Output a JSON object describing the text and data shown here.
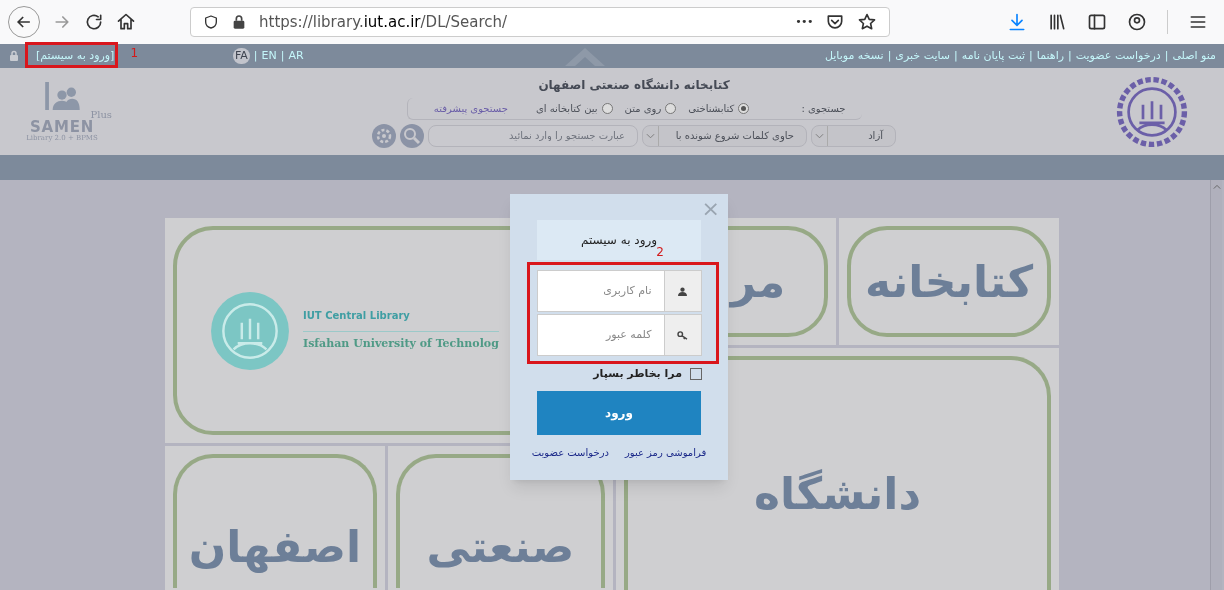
{
  "browser": {
    "url_prefix": "https://library.",
    "url_host": "iut.ac.ir",
    "url_path": "/DL/Search/",
    "more": "•••"
  },
  "top_bar": {
    "login_link": "[ورود به سیستم]",
    "annotation": "1",
    "languages": [
      {
        "label": "AR",
        "selected": false
      },
      {
        "label": "EN",
        "selected": false
      },
      {
        "label": "FA",
        "selected": true
      }
    ],
    "separator": "|",
    "links": [
      "منو اصلی",
      "درخواست عضویت",
      "راهنما",
      "ثبت پایان نامه",
      "سایت خبری",
      "نسخه موبایل"
    ]
  },
  "header": {
    "title": "کتابخانه دانشگاه صنعتی اصفهان",
    "logo": {
      "plus": "Plus",
      "name": "SAMEN",
      "tagline": "Library 2.0 + BPMS"
    },
    "search_label": "جستجوی :",
    "search_types": [
      {
        "label": "کتابشناختی",
        "selected": true
      },
      {
        "label": "روی متن",
        "selected": false
      },
      {
        "label": "بین کتابخانه ای",
        "selected": false
      }
    ],
    "advanced_link": "جستجوی پیشرفته",
    "field_select": "آزاد",
    "match_select": "حاوی کلمات شروع شونده با",
    "search_placeholder": "عبارت جستجو را وارد نمائید"
  },
  "tiles": {
    "iut_line1": "IUT Central Library",
    "iut_line2": "Isfahan University of Technolog",
    "words": [
      "مر",
      "کتابخانه",
      "دانشگاه",
      "اصفهان",
      "صنعتی"
    ]
  },
  "login_dialog": {
    "close": "×",
    "title": "ورود به سیستم",
    "annotation": "2",
    "username_placeholder": "نام کاربری",
    "password_placeholder": "کلمه عبور",
    "remember": {
      "label": "مرا بخاطر بسپار",
      "checked": false
    },
    "submit": "ورود",
    "links": [
      "فراموشی رمز عبور",
      "درخواست عضویت"
    ]
  }
}
